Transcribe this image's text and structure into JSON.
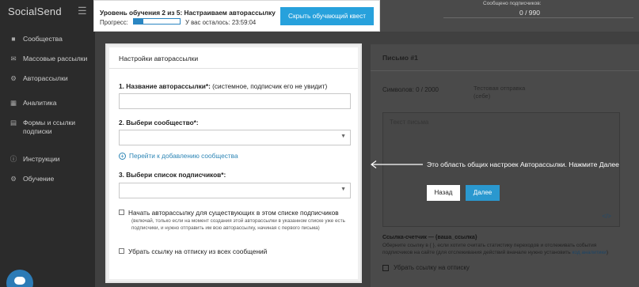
{
  "app": {
    "logo": "SocialSend",
    "menu_icon": "hamburger-icon"
  },
  "sidebar": {
    "items": [
      {
        "label": "Сообщества",
        "icon": "community-icon"
      },
      {
        "label": "Массовые рассылки",
        "icon": "chat-icon"
      },
      {
        "label": "Авторассылки",
        "icon": "wrench-icon"
      },
      {
        "label": "Аналитика",
        "icon": "chart-icon"
      },
      {
        "label": "Формы и ссылки подписки",
        "icon": "form-icon"
      },
      {
        "label": "Инструкции",
        "icon": "info-icon"
      },
      {
        "label": "Обучение",
        "icon": "gear-icon"
      }
    ]
  },
  "tutorial": {
    "title": "Уровень обучения 2 из 5: Настраиваем авторассылку",
    "progress_label": "Прогресс:",
    "progress_fraction": 0.2,
    "remaining": "У вас осталось: 23:59:04",
    "hide_button": "Скрыть обучающий квест"
  },
  "subscribers": {
    "caption": "Сообщено подписчиков:",
    "value": "0 / 990"
  },
  "settings_card": {
    "title": "Настройки авторассылки",
    "name_label_bold": "1. Название авторассылки*:",
    "name_label_note": " (системное, подписчик его не увидит)",
    "name_value": "",
    "community_label": "2. Выбери сообщество*:",
    "community_value": "",
    "add_community_link": "Перейти к добавлению сообщества",
    "list_label": "3. Выбери список подписчиков*:",
    "list_value": "",
    "start_existing_label": "Начать авторассылку для существующих в этом списке подписчиков",
    "start_existing_note": "(включай, только если на момент создания этой авторассылки в указанном списке уже есть подписчики, и нужно отправить им всю авторассылку, начиная с первого письма)",
    "unsubscribe_label": "Убрать ссылку на отписку из всех сообщений"
  },
  "letter_panel": {
    "title": "Письмо #1",
    "symbols": "Символов: 0 / 2000",
    "test_send": "Тестовая отправка (себе)",
    "text_placeholder": "Текст письма",
    "code_icon": "code-icon",
    "link_counter_title": "Ссылка-счетчик — {ваша_ссылка}",
    "link_counter_desc": "Оберните ссылку в { }, если хотите считать статистику переходов и отслеживать события подписчиков на сайте (для отслеживания действий вначале нужно установить ",
    "link_counter_link": "код аналитики",
    "link_counter_end": ")",
    "unsubscribe_label": "Убрать ссылку на отписку"
  },
  "annotation": {
    "arrow_icon": "left-arrow-icon",
    "text": "Это область общих настроек Авторассылки. Нажмите Далее",
    "back_button": "Назад",
    "next_button": "Далее"
  },
  "chat_widget": {
    "icon": "chat-bubble-icon"
  },
  "colors": {
    "accent": "#27a1dc",
    "link": "#2c85b5",
    "sidebar_bg": "#2b2b2b",
    "overlay_bg": "#404040"
  }
}
